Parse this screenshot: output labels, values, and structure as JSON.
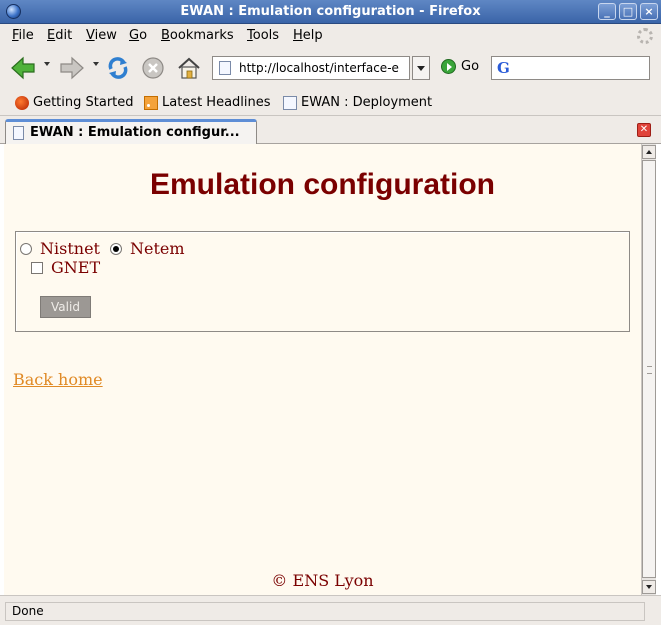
{
  "window": {
    "title": "EWAN : Emulation configuration - Firefox",
    "controls": [
      "_",
      "□",
      "×"
    ]
  },
  "menu": [
    {
      "accel": "F",
      "rest": "ile"
    },
    {
      "accel": "E",
      "rest": "dit"
    },
    {
      "accel": "V",
      "rest": "iew"
    },
    {
      "accel": "G",
      "rest": "o"
    },
    {
      "accel": "B",
      "rest": "ookmarks"
    },
    {
      "accel": "T",
      "rest": "ools"
    },
    {
      "accel": "H",
      "rest": "elp"
    }
  ],
  "toolbar": {
    "url": "http://localhost/interface-e",
    "go_label": "Go",
    "search_engine_letter": "G"
  },
  "bookmarks": [
    {
      "label": "Getting Started",
      "icon": "firefox-icon"
    },
    {
      "label": "Latest Headlines",
      "icon": "rss-icon"
    },
    {
      "label": "EWAN : Deployment",
      "icon": "page-icon"
    }
  ],
  "tab": {
    "title": "EWAN : Emulation configur..."
  },
  "page": {
    "heading": "Emulation configuration",
    "radio_options": [
      {
        "label": "Nistnet",
        "checked": false
      },
      {
        "label": "Netem",
        "checked": true
      }
    ],
    "checkbox_label": "GNET",
    "checkbox_checked": false,
    "submit_label": "Valid",
    "back_link": "Back home",
    "footer": "© ENS Lyon"
  },
  "status": {
    "text": "Done"
  },
  "colors": {
    "heading": "#7a0000",
    "link": "#e08a26",
    "page_bg": "#fffaf0",
    "chrome_bg": "#efebe7",
    "titlebar": "#3a64a8"
  }
}
